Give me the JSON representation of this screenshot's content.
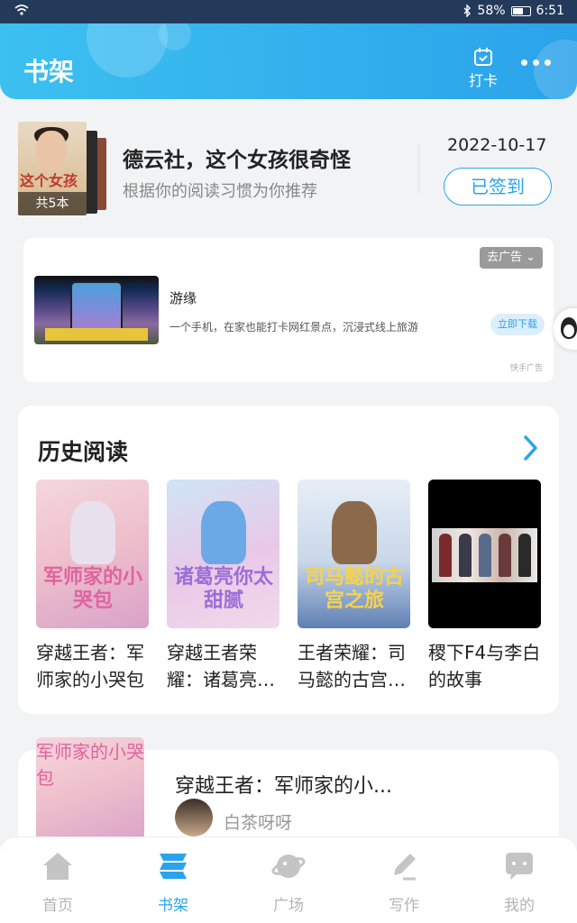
{
  "status_bar": {
    "battery": "58%",
    "time": "6:51"
  },
  "header": {
    "title": "书架",
    "checkin_label": "打卡"
  },
  "recommendation": {
    "count_badge": "共5本",
    "title": "德云社，这个女孩很奇怪",
    "subtitle": "根据你的阅读习惯为你推荐",
    "date": "2022-10-17",
    "signed_label": "已签到"
  },
  "ad": {
    "close_label": "去广告",
    "name": "游缘",
    "description": "一个手机，在家也能打卡网红景点，沉浸式线上旅游",
    "download_label": "立即下载",
    "source": "快手广告"
  },
  "history": {
    "title": "历史阅读",
    "books": [
      {
        "name": "穿越王者：军师家的小哭包",
        "cover_title": "军师家的小哭包"
      },
      {
        "name": "穿越王者荣耀：诸葛亮你太甜腻",
        "cover_title": "诸葛亮你太甜腻"
      },
      {
        "name": "王者荣耀：司马懿的古宫之旅",
        "cover_title": "司马懿的古宫之旅"
      },
      {
        "name": "稷下F4与李白的故事",
        "cover_title": ""
      }
    ]
  },
  "last_book": {
    "title": "穿越王者：军师家的小...",
    "author": "白茶呀呀"
  },
  "tabs": [
    {
      "label": "首页",
      "icon": "home-icon"
    },
    {
      "label": "书架",
      "icon": "bookshelf-icon"
    },
    {
      "label": "广场",
      "icon": "planet-icon"
    },
    {
      "label": "写作",
      "icon": "pen-icon"
    },
    {
      "label": "我的",
      "icon": "chat-bubble-icon"
    }
  ],
  "colors": {
    "accent": "#2ba3ea",
    "header_start": "#3cc0f0",
    "inactive": "#b4b4b4"
  }
}
